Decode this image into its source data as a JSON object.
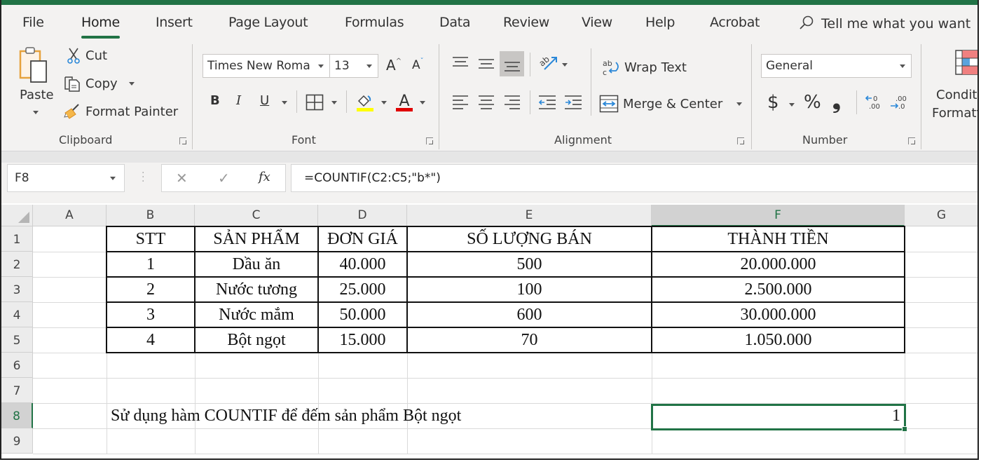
{
  "app": {
    "accent_color": "#217346"
  },
  "tabs": [
    {
      "label": "File",
      "active": false
    },
    {
      "label": "Home",
      "active": true
    },
    {
      "label": "Insert",
      "active": false
    },
    {
      "label": "Page Layout",
      "active": false
    },
    {
      "label": "Formulas",
      "active": false
    },
    {
      "label": "Data",
      "active": false
    },
    {
      "label": "Review",
      "active": false
    },
    {
      "label": "View",
      "active": false
    },
    {
      "label": "Help",
      "active": false
    },
    {
      "label": "Acrobat",
      "active": false
    }
  ],
  "tell_me": {
    "placeholder": "Tell me what you want",
    "icon": "search-icon"
  },
  "ribbon": {
    "clipboard": {
      "label": "Clipboard",
      "paste": "Paste",
      "cut": "Cut",
      "copy": "Copy",
      "format_painter": "Format Painter"
    },
    "font": {
      "label": "Font",
      "font_name": "Times New Roma",
      "font_size": "13",
      "grow": "A",
      "shrink": "A",
      "bold": "B",
      "italic": "I",
      "underline": "U",
      "highlight_color": "#ffff00",
      "font_color": "#e00000",
      "font_color_glyph": "A"
    },
    "alignment": {
      "label": "Alignment",
      "wrap_text": "Wrap Text",
      "merge_center": "Merge & Center"
    },
    "number": {
      "label": "Number",
      "format": "General",
      "currency": "$",
      "percent": "%",
      "comma": "❟"
    },
    "styles": {
      "conditional_formatting_line1": "Condit",
      "conditional_formatting_line2": "Formatt"
    }
  },
  "formula_bar": {
    "name_box": "F8",
    "cancel": "✕",
    "enter": "✓",
    "fx": "fx",
    "formula": "=COUNTIF(C2:C5;\"b*\")"
  },
  "sheet": {
    "columns": [
      "A",
      "B",
      "C",
      "D",
      "E",
      "F",
      "G"
    ],
    "selected_column": "F",
    "rows": [
      "1",
      "2",
      "3",
      "4",
      "5",
      "6",
      "7",
      "8",
      "9"
    ],
    "selected_row": "8",
    "selected_cell": "F8",
    "table": {
      "headers": [
        "STT",
        "SẢN PHẨM",
        "ĐƠN GIÁ",
        "SỐ LƯỢNG BÁN",
        "THÀNH TIỀN"
      ],
      "rows": [
        [
          "1",
          "Dầu ăn",
          "40.000",
          "500",
          "20.000.000"
        ],
        [
          "2",
          "Nước tương",
          "25.000",
          "100",
          "2.500.000"
        ],
        [
          "3",
          "Nước mắm",
          "50.000",
          "600",
          "30.000.000"
        ],
        [
          "4",
          "Bột ngọt",
          "15.000",
          "70",
          "1.050.000"
        ]
      ]
    },
    "b8_text": "Sử dụng hàm COUNTIF để đếm sản phẩm Bột ngọt",
    "f8_value": "1"
  }
}
